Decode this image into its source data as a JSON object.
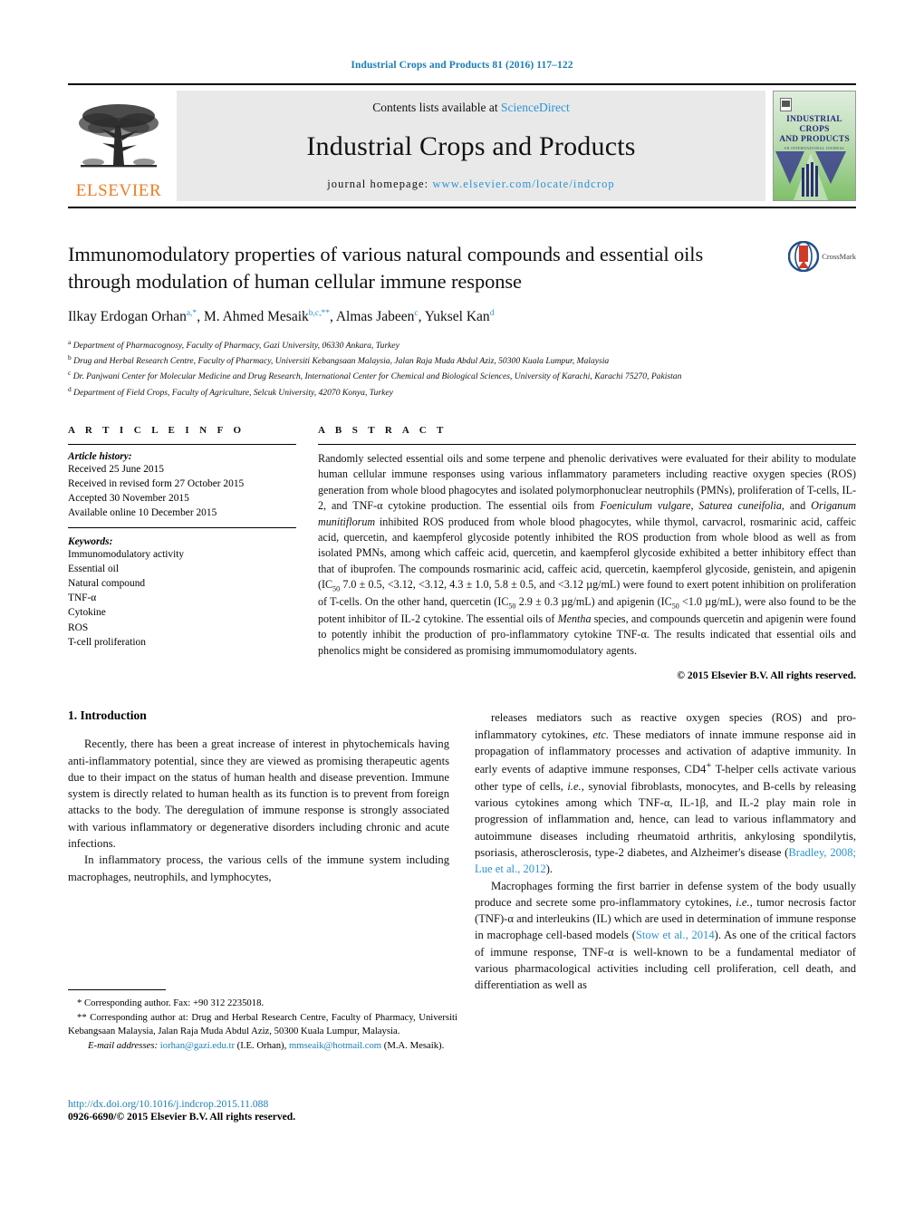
{
  "running_head": "Industrial Crops and Products 81 (2016) 117–122",
  "masthead": {
    "contents_prefix": "Contents lists available at ",
    "sciencedirect": "ScienceDirect",
    "journal_name": "Industrial Crops and Products",
    "homepage_label": "journal homepage:",
    "homepage_url": "www.elsevier.com/locate/indcrop",
    "publisher": "ELSEVIER",
    "cover_title_line1": "INDUSTRIAL CROPS",
    "cover_title_line2": "AND PRODUCTS",
    "cover_subtitle": "AN INTERNATIONAL JOURNAL"
  },
  "article": {
    "title": "Immunomodulatory properties of various natural compounds and essential oils through modulation of human cellular immune response",
    "crossmark_label": "CrossMark",
    "authors_html": "Ilkay Erdogan Orhan<sup>a,*</sup>, M. Ahmed Mesaik<sup>b,c,**</sup>, Almas Jabeen<sup>c</sup>, Yuksel Kan<sup>d</sup>",
    "affiliations": [
      {
        "marker": "a",
        "text": "Department of Pharmacognosy, Faculty of Pharmacy, Gazi University, 06330 Ankara, Turkey"
      },
      {
        "marker": "b",
        "text": "Drug and Herbal Research Centre, Faculty of Pharmacy, Universiti Kebangsaan Malaysia, Jalan Raja Muda Abdul Aziz, 50300 Kuala Lumpur, Malaysia"
      },
      {
        "marker": "c",
        "text": "Dr. Panjwani Center for Molecular Medicine and Drug Research, International Center for Chemical and Biological Sciences, University of Karachi, Karachi 75270, Pakistan"
      },
      {
        "marker": "d",
        "text": "Department of Field Crops, Faculty of Agriculture, Selcuk University, 42070 Konya, Turkey"
      }
    ]
  },
  "article_info": {
    "heading": "A R T I C L E   I N F O",
    "history_label": "Article history:",
    "history": [
      "Received 25 June 2015",
      "Received in revised form 27 October 2015",
      "Accepted 30 November 2015",
      "Available online 10 December 2015"
    ],
    "keywords_label": "Keywords:",
    "keywords": [
      "Immunomodulatory activity",
      "Essential oil",
      "Natural compound",
      "TNF-α",
      "Cytokine",
      "ROS",
      "T-cell proliferation"
    ]
  },
  "abstract": {
    "heading": "A B S T R A C T",
    "html": "Randomly selected essential oils and some terpene and phenolic derivatives were evaluated for their ability to modulate human cellular immune responses using various inflammatory parameters including reactive oxygen species (ROS) generation from whole blood phagocytes and isolated polymorphonuclear neutrophils (PMNs), proliferation of T-cells, IL-2, and TNF-α cytokine production. The essential oils from <i>Foeniculum vulgare</i>, <i>Saturea cuneifolia</i>, and <i>Origanum munitiflorum</i> inhibited ROS produced from whole blood phagocytes, while thymol, carvacrol, rosmarinic acid, caffeic acid, quercetin, and kaempferol glycoside potently inhibited the ROS production from whole blood as well as from isolated PMNs, among which caffeic acid, quercetin, and kaempferol glycoside exhibited a better inhibitory effect than that of ibuprofen. The compounds rosmarinic acid, caffeic acid, quercetin, kaempferol glycoside, genistein, and apigenin (IC<sub>50</sub> 7.0 ± 0.5, &lt;3.12, &lt;3.12, 4.3 ± 1.0, 5.8 ± 0.5, and &lt;3.12 µg/mL) were found to exert potent inhibition on proliferation of T-cells. On the other hand, quercetin (IC<sub>50</sub> 2.9 ± 0.3 µg/mL) and apigenin (IC<sub>50</sub> &lt;1.0 µg/mL), were also found to be the potent inhibitor of IL-2 cytokine. The essential oils of <i>Mentha</i> species, and compounds quercetin and apigenin were found to potently inhibit the production of pro-inflammatory cytokine TNF-α. The results indicated that essential oils and phenolics might be considered as promising immumomodulatory agents.",
    "copyright": "© 2015 Elsevier B.V. All rights reserved."
  },
  "introduction": {
    "heading": "1.  Introduction",
    "left_paragraphs": [
      "Recently, there has been a great increase of interest in phytochemicals having anti-inflammatory potential, since they are viewed as promising therapeutic agents due to their impact on the status of human health and disease prevention. Immune system is directly related to human health as its function is to prevent from foreign attacks to the body. The deregulation of immune response is strongly associated with various inflammatory or degenerative disorders including chronic and acute infections.",
      "In inflammatory process, the various cells of the immune system including macrophages, neutrophils, and lymphocytes,"
    ],
    "right_paragraphs_html": [
      "releases mediators such as reactive oxygen species (ROS) and pro-inflammatory cytokines, <i>etc.</i> These mediators of innate immune response aid in propagation of inflammatory processes and activation of adaptive immunity. In early events of adaptive immune responses, CD4<sup>+</sup> T-helper cells activate various other type of cells, <i>i.e.</i>, synovial fibroblasts, monocytes, and B-cells by releasing various cytokines among which TNF-α, IL-1β, and IL-2 play main role in progression of inflammation and, hence, can lead to various inflammatory and autoimmune diseases including rheumatoid arthritis, ankylosing spondilytis, psoriasis, atherosclerosis, type-2 diabetes, and Alzheimer's disease (<span class=\"cite\">Bradley, 2008; Lue et al., 2012</span>).",
      "Macrophages forming the first barrier in defense system of the body usually produce and secrete some pro-inflammatory cytokines, <i>i.e.</i>, tumor necrosis factor (TNF)-α and interleukins (IL) which are used in determination of immune response in macrophage cell-based models (<span class=\"cite\">Stow et al., 2014</span>). As one of the critical factors of immune response, TNF-α is well-known to be a fundamental mediator of various pharmacological activities including cell proliferation, cell death, and differentiation as well as"
    ]
  },
  "footnotes": {
    "corresponding_1": "*  Corresponding author. Fax: +90 312 2235018.",
    "corresponding_2": "**  Corresponding author at: Drug and Herbal Research Centre, Faculty of Pharmacy, Universiti Kebangsaan Malaysia, Jalan Raja Muda Abdul Aziz, 50300 Kuala Lumpur, Malaysia.",
    "email_label": "E-mail addresses:",
    "email_1": "iorhan@gazi.edu.tr",
    "email_1_owner": "(I.E. Orhan),",
    "email_2": "mmseaik@hotmail.com",
    "email_2_owner": "(M.A. Mesaik)."
  },
  "doi_block": {
    "doi": "http://dx.doi.org/10.1016/j.indcrop.2015.11.088",
    "issn": "0926-6690/© 2015 Elsevier B.V. All rights reserved."
  },
  "colors": {
    "link_blue": "#1a7db6",
    "accent_blue": "#2b93d1",
    "elsevier_orange": "#ef7d22",
    "masthead_grey": "#e9e9ea"
  }
}
